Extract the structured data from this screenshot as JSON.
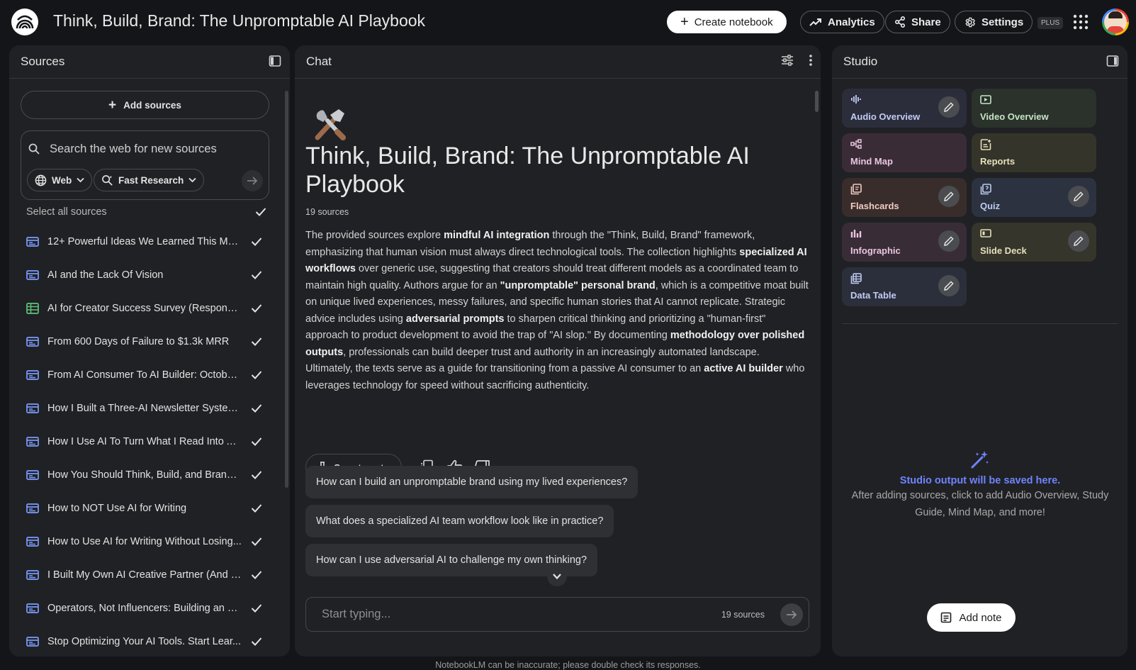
{
  "header": {
    "title": "Think, Build, Brand: The Unpromptable AI Playbook",
    "create_label": "Create notebook",
    "analytics_label": "Analytics",
    "share_label": "Share",
    "settings_label": "Settings",
    "plan_badge": "PLUS"
  },
  "sources": {
    "title": "Sources",
    "add_label": "Add sources",
    "search_placeholder": "Search the web for new sources",
    "web_chip": "Web",
    "research_chip": "Fast Research",
    "select_all_label": "Select all sources",
    "items": [
      {
        "name": "12+ Powerful Ideas We Learned This Mon...",
        "icon": "doc-icon"
      },
      {
        "name": "AI and the Lack Of Vision",
        "icon": "doc-icon"
      },
      {
        "name": "AI for Creator Success Survey (Response...",
        "icon": "sheet-icon"
      },
      {
        "name": "From 600 Days of Failure to $1.3k MRR",
        "icon": "doc-icon"
      },
      {
        "name": "From AI Consumer To AI Builder: October...",
        "icon": "doc-icon"
      },
      {
        "name": "How I Built a Three-AI Newsletter System...",
        "icon": "doc-icon"
      },
      {
        "name": "How I Use AI To Turn What I Read Into A L...",
        "icon": "doc-icon"
      },
      {
        "name": "How You Should Think, Build, and Brand ...",
        "icon": "doc-icon"
      },
      {
        "name": "How to NOT Use AI for Writing",
        "icon": "doc-icon"
      },
      {
        "name": "How to Use AI for Writing Without Losing...",
        "icon": "doc-icon"
      },
      {
        "name": "I Built My Own AI Creative Partner (And It...",
        "icon": "doc-icon"
      },
      {
        "name": "Operators, Not Influencers: Building an U...",
        "icon": "doc-icon"
      },
      {
        "name": "Stop Optimizing Your AI Tools. Start Lear...",
        "icon": "doc-icon"
      }
    ]
  },
  "chat": {
    "title": "Chat",
    "notebook_title": "Think, Build, Brand: The Unpromptable AI Playbook",
    "source_count": "19 sources",
    "summary": [
      {
        "t": "The provided sources explore ",
        "b": false
      },
      {
        "t": "mindful AI integration",
        "b": true
      },
      {
        "t": " through the \"Think, Build, Brand\" framework, emphasizing that human vision must always direct technological tools. The collection highlights ",
        "b": false
      },
      {
        "t": "specialized AI workflows",
        "b": true
      },
      {
        "t": " over generic use, suggesting that creators should treat different models as a coordinated team to maintain high quality. Authors argue for an ",
        "b": false
      },
      {
        "t": "\"unpromptable\" personal brand",
        "b": true
      },
      {
        "t": ", which is a competitive moat built on unique lived experiences, messy failures, and specific human stories that AI cannot replicate. Strategic advice includes using ",
        "b": false
      },
      {
        "t": "adversarial prompts",
        "b": true
      },
      {
        "t": " to sharpen critical thinking and prioritizing a \"human-first\" approach to product development to avoid the trap of \"AI slop.\" By documenting ",
        "b": false
      },
      {
        "t": "methodology over polished outputs",
        "b": true
      },
      {
        "t": ", professionals can build deeper trust and authority in an increasingly automated landscape. Ultimately, the texts serve as a guide for transitioning from a passive AI consumer to an ",
        "b": false
      },
      {
        "t": "active AI builder",
        "b": true
      },
      {
        "t": " who leverages technology for speed without sacrificing authenticity.",
        "b": false
      }
    ],
    "save_note_label": "Save to note",
    "suggestions": [
      "How can I build an unpromptable brand using my lived experiences?",
      "What does a specialized AI team workflow look like in practice?",
      "How can I use adversarial AI to challenge my own thinking?"
    ],
    "input_placeholder": "Start typing...",
    "input_source_count": "19 sources",
    "disclaimer": "NotebookLM can be inaccurate; please double check its responses."
  },
  "studio": {
    "title": "Studio",
    "tiles": [
      {
        "label": "Audio Overview",
        "icon": "waveform-icon",
        "bg": "#2b2e3a",
        "fg": "#c3cbf5",
        "edit": true
      },
      {
        "label": "Video Overview",
        "icon": "video-icon",
        "bg": "#2a322b",
        "fg": "#c7e3c7",
        "edit": false
      },
      {
        "label": "Mind Map",
        "icon": "mindmap-icon",
        "bg": "#3a2c37",
        "fg": "#e9c5df",
        "edit": false
      },
      {
        "label": "Reports",
        "icon": "reports-icon",
        "bg": "#35342a",
        "fg": "#e5e0bc",
        "edit": false
      },
      {
        "label": "Flashcards",
        "icon": "flashcards-icon",
        "bg": "#392d2b",
        "fg": "#f0cbc3",
        "edit": true
      },
      {
        "label": "Quiz",
        "icon": "quiz-icon",
        "bg": "#2c3240",
        "fg": "#bccdf0",
        "edit": true
      },
      {
        "label": "Infographic",
        "icon": "infographic-icon",
        "bg": "#382c37",
        "fg": "#e9c5df",
        "edit": true
      },
      {
        "label": "Slide Deck",
        "icon": "slides-icon",
        "bg": "#36352b",
        "fg": "#e6e0bb",
        "edit": true
      },
      {
        "label": "Data Table",
        "icon": "table-icon",
        "bg": "#2b2f3b",
        "fg": "#c3cbf5",
        "edit": true
      }
    ],
    "empty_title": "Studio output will be saved here.",
    "empty_body": "After adding sources, click to add Audio Overview, Study Guide, Mind Map, and more!",
    "add_note_label": "Add note"
  }
}
